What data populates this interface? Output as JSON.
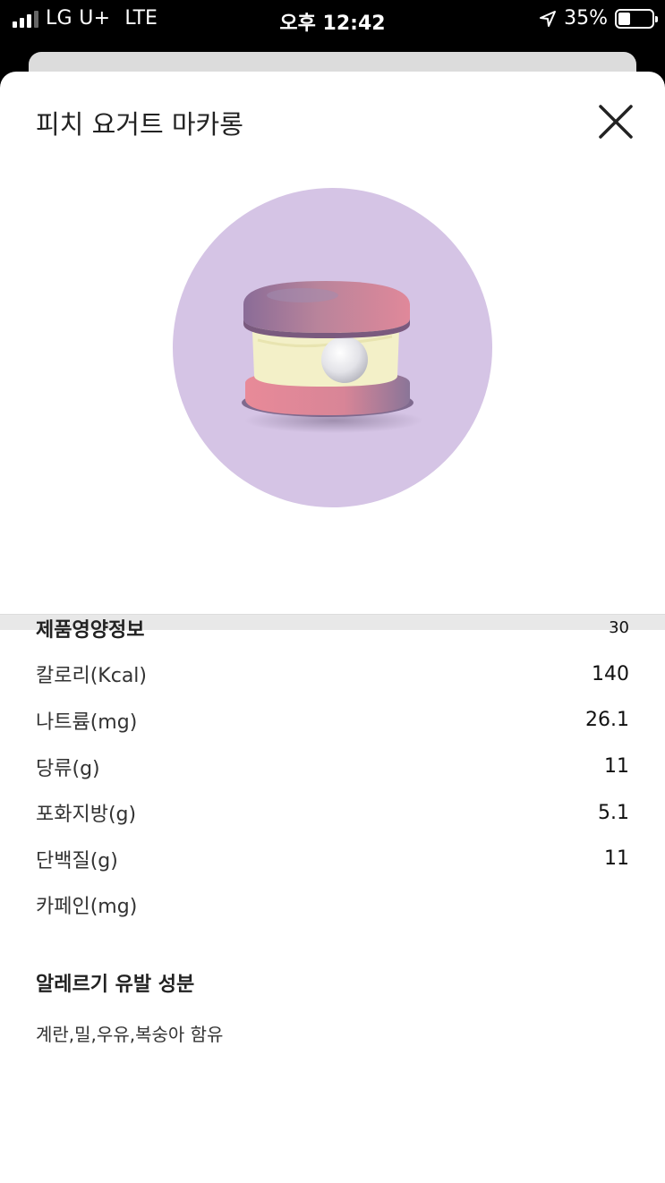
{
  "status_bar": {
    "carrier": "LG U+",
    "network": "LTE",
    "time": "오후 12:42",
    "battery": "35%",
    "battery_level": 0.35
  },
  "modal": {
    "title": "피치 요거트 마카롱",
    "close_icon": "close-x-icon",
    "image_bg": "#d5c4e5"
  },
  "nutrition": {
    "header": "제품영양정보",
    "serving": "30",
    "rows": [
      {
        "label": "칼로리(Kcal)",
        "value": "140"
      },
      {
        "label": "나트륨(mg)",
        "value": "26.1"
      },
      {
        "label": "당류(g)",
        "value": "11"
      },
      {
        "label": "포화지방(g)",
        "value": "5.1"
      },
      {
        "label": "단백질(g)",
        "value": "11"
      },
      {
        "label": "카페인(mg)",
        "value": ""
      }
    ]
  },
  "allergy": {
    "title": "알레르기 유발 성분",
    "text": "계란,밀,우유,복숭아 함유"
  }
}
